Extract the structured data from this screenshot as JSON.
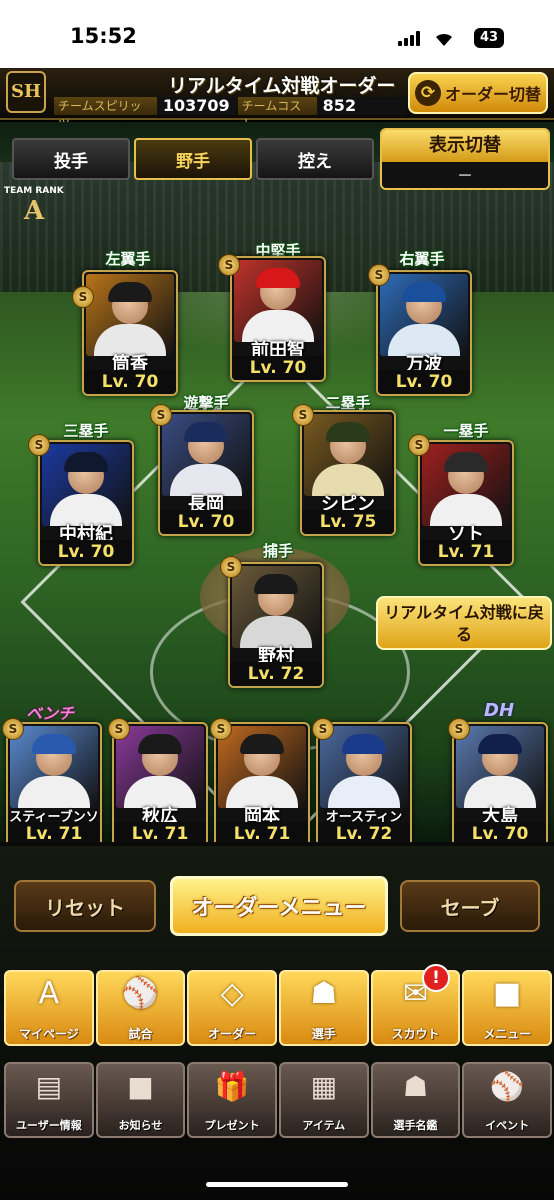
{
  "status_bar": {
    "time": "15:52",
    "battery": "43"
  },
  "header": {
    "logo_text": "SH",
    "title": "リアルタイム対戦オーダー",
    "team_spirits_label": "チームスピリッツ",
    "team_spirits_value": "103709",
    "team_cost_label": "チームコスト",
    "team_cost_value": "852",
    "swap_order_label": "オーダー切替"
  },
  "tabs": [
    {
      "label": "投手",
      "active": false
    },
    {
      "label": "野手",
      "active": true
    },
    {
      "label": "控え",
      "active": false
    }
  ],
  "display_toggle": {
    "label": "表示切替",
    "value": "－"
  },
  "team_rank": {
    "label": "TEAM RANK",
    "value": "A"
  },
  "fielders": [
    {
      "position": "左翼手",
      "name": "筒香",
      "level": "Lv. 70",
      "cap": "#1a1a1a",
      "uniform": "#e8e8e8",
      "bg": "#b8741a"
    },
    {
      "position": "中堅手",
      "name": "前田智",
      "level": "Lv. 70",
      "cap": "#d81818",
      "uniform": "#f0f0f0",
      "bg": "#c0332a"
    },
    {
      "position": "右翼手",
      "name": "万波",
      "level": "Lv. 70",
      "cap": "#1a4f9c",
      "uniform": "#dde8f5",
      "bg": "#2e6bb8"
    },
    {
      "position": "三塁手",
      "name": "中村紀",
      "level": "Lv. 70",
      "cap": "#101830",
      "uniform": "#f0f0f0",
      "bg": "#1c3aa0"
    },
    {
      "position": "遊撃手",
      "name": "長岡",
      "level": "Lv. 70",
      "cap": "#1a2c5c",
      "uniform": "#e6e6ee",
      "bg": "#3a4c82"
    },
    {
      "position": "二塁手",
      "name": "シピン",
      "level": "Lv. 75",
      "cap": "#2a3a1a",
      "uniform": "#e6dcae",
      "bg": "#7a5a20"
    },
    {
      "position": "一塁手",
      "name": "ソト",
      "level": "Lv. 71",
      "cap": "#2a2a2a",
      "uniform": "#f0f0f0",
      "bg": "#a02020"
    },
    {
      "position": "捕手",
      "name": "野村",
      "level": "Lv. 72",
      "cap": "#1a1a1a",
      "uniform": "#d8d8d8",
      "bg": "#6a5a3a"
    }
  ],
  "bench_label": "ベンチ",
  "dh_label": "DH",
  "bench": [
    {
      "name": "スティーブンソン",
      "level": "Lv. 71",
      "cap": "#2a5ab0",
      "uniform": "#f0f0f0",
      "bg": "#5a8ad0"
    },
    {
      "name": "秋広",
      "level": "Lv. 71",
      "cap": "#1a1a1a",
      "uniform": "#f0f0f0",
      "bg": "#8a3a9a"
    },
    {
      "name": "岡本",
      "level": "Lv. 71",
      "cap": "#1a1a1a",
      "uniform": "#f0f0f0",
      "bg": "#c06a20"
    },
    {
      "name": "オースティン",
      "level": "Lv. 72",
      "cap": "#1a3a8a",
      "uniform": "#e8eef8",
      "bg": "#4a6aa0"
    },
    {
      "name": "大島",
      "level": "Lv. 70",
      "cap": "#10204a",
      "uniform": "#f0f0f0",
      "bg": "#5a7ab0"
    }
  ],
  "realtime_back_button": "リアルタイム対戦に戻る",
  "actions": {
    "reset": "リセット",
    "order_menu": "オーダーメニュー",
    "save": "セーブ"
  },
  "nav_primary": [
    {
      "label": "マイページ",
      "icon": "A"
    },
    {
      "label": "試合",
      "icon": "⚾"
    },
    {
      "label": "オーダー",
      "icon": "◇"
    },
    {
      "label": "選手",
      "icon": "☗"
    },
    {
      "label": "スカウト",
      "icon": "✉"
    },
    {
      "label": "メニュー",
      "icon": "■"
    }
  ],
  "scout_badge": "!",
  "nav_secondary": [
    {
      "label": "ユーザー情報",
      "icon": "▤"
    },
    {
      "label": "お知らせ",
      "icon": "■"
    },
    {
      "label": "プレゼント",
      "icon": "🎁"
    },
    {
      "label": "アイテム",
      "icon": "▦"
    },
    {
      "label": "選手名鑑",
      "icon": "☗"
    },
    {
      "label": "イベント",
      "icon": "⚾"
    }
  ]
}
